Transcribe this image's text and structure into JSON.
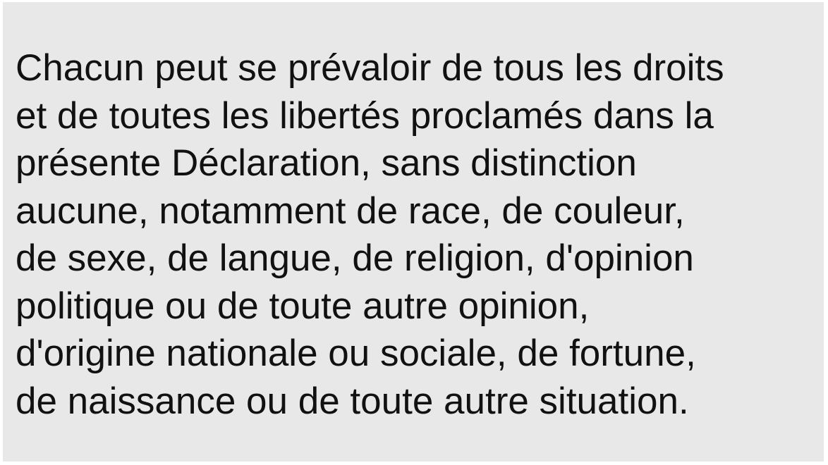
{
  "document": {
    "lines": [
      "Chacun peut se prévaloir de tous les droits",
      "et de toutes les libertés proclamés dans la",
      "présente Déclaration, sans distinction",
      "aucune, notamment de race, de couleur,",
      "de sexe, de langue, de religion, d'opinion",
      "politique ou de toute autre opinion,",
      "d'origine nationale ou sociale, de fortune,",
      "de naissance ou de toute autre situation."
    ]
  },
  "colors": {
    "background": "#e8e8e8",
    "text": "#111111"
  }
}
